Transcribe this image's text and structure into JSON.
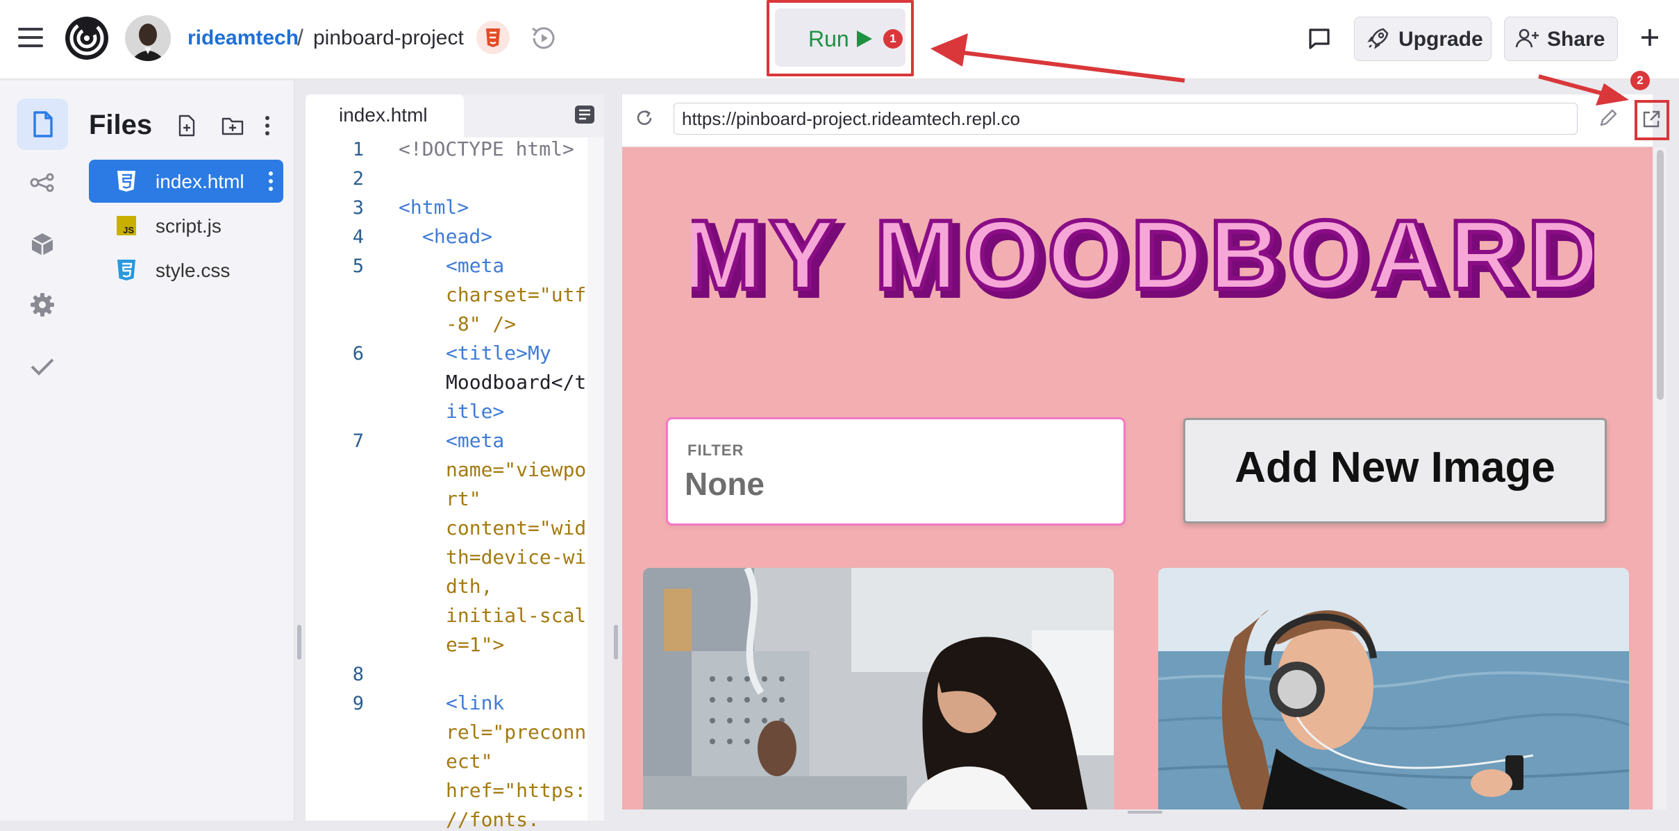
{
  "topbar": {
    "owner": "rideamtech",
    "separator": "/",
    "project": "pinboard-project",
    "run_label": "Run",
    "upgrade_label": "Upgrade",
    "share_label": "Share"
  },
  "annotations": {
    "badge_1": "1",
    "badge_2": "2"
  },
  "sidebar": {
    "title": "Files"
  },
  "files": [
    {
      "name": "index.html",
      "icon": "html5-icon",
      "selected": true
    },
    {
      "name": "script.js",
      "icon": "js-icon"
    },
    {
      "name": "style.css",
      "icon": "css3-icon"
    }
  ],
  "editor": {
    "tab_label": "index.html",
    "line_numbers": [
      "1",
      "2",
      "3",
      "4",
      "5",
      "6",
      "7",
      "8",
      "9"
    ],
    "lines": [
      "<!DOCTYPE html>",
      "<html>",
      "<head>",
      "<meta",
      "charset=\"utf",
      "-8\" />",
      "<title>My",
      "Moodboard</t",
      "itle>",
      "<meta",
      "name=\"viewpo",
      "rt\"",
      "content=\"wid",
      "th=device-wi",
      "dth,",
      "initial-scal",
      "e=1\">",
      "<link",
      "rel=\"preconn",
      "ect\"",
      "href=\"https:",
      "//fonts."
    ]
  },
  "webview": {
    "url": "https://pinboard-project.rideamtech.repl.co",
    "site_title": "MY MOODBOARD",
    "filter_label": "FILTER",
    "filter_value": "None",
    "add_button_label": "Add New Image"
  },
  "colors": {
    "accent_blue": "#2c7be5",
    "run_green": "#1e9141",
    "annotation_red": "#d9373a",
    "site_background": "#f2aeb1",
    "title_purple": "#8a0d86",
    "title_fill": "#f6a7d7"
  }
}
